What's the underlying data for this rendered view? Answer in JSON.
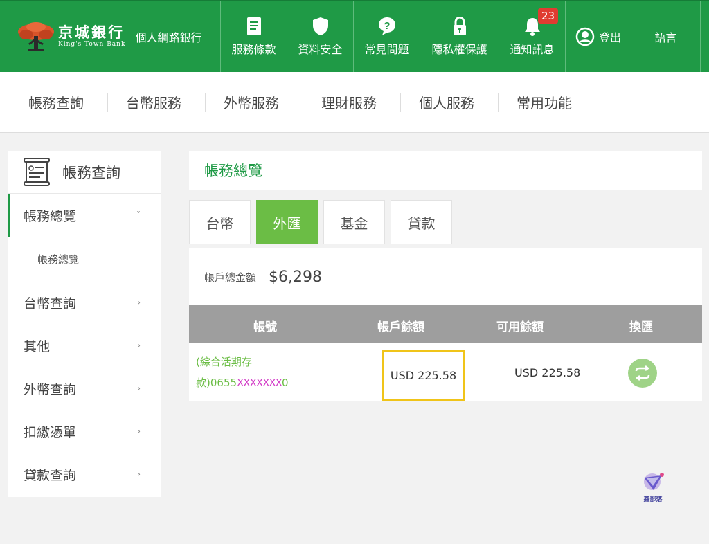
{
  "brand": {
    "name_cn": "京城銀行",
    "name_en": "King's Town Bank",
    "subtitle": "個人網路銀行"
  },
  "header_nav": [
    {
      "label": "服務條款",
      "icon": "document-icon"
    },
    {
      "label": "資料安全",
      "icon": "shield-icon"
    },
    {
      "label": "常見問題",
      "icon": "question-icon"
    },
    {
      "label": "隱私權保護",
      "icon": "lock-icon"
    },
    {
      "label": "通知訊息",
      "icon": "bell-icon",
      "badge": "23"
    },
    {
      "label": "登出",
      "icon": "user-icon"
    },
    {
      "label": "語言"
    }
  ],
  "main_nav": [
    "帳務查詢",
    "台幣服務",
    "外幣服務",
    "理財服務",
    "個人服務",
    "常用功能"
  ],
  "sidebar": {
    "title": "帳務查詢",
    "items": [
      {
        "label": "帳務總覽",
        "chevron": "˅",
        "active": true
      },
      {
        "label": "帳務總覽",
        "sub": true
      },
      {
        "label": "台幣查詢",
        "chevron": "›"
      },
      {
        "label": "其他",
        "chevron": "›"
      },
      {
        "label": "外幣查詢",
        "chevron": "›"
      },
      {
        "label": "扣繳憑單",
        "chevron": "›"
      },
      {
        "label": "貸款查詢",
        "chevron": "›"
      }
    ]
  },
  "page": {
    "title": "帳務總覽",
    "tabs": [
      "台幣",
      "外匯",
      "基金",
      "貸款"
    ],
    "active_tab": "外匯",
    "total_label": "帳戶總金額",
    "total_value": "$6,298",
    "table": {
      "headers": [
        "帳號",
        "帳戶餘額",
        "可用餘額",
        "換匯"
      ],
      "rows": [
        {
          "account_line1": "(綜合活期存",
          "account_line2_prefix": "款)0655",
          "account_mask": "XXXXXXX",
          "account_suffix": "0",
          "balance": "USD 225.58",
          "available": "USD 225.58"
        }
      ]
    }
  },
  "watermark": {
    "text": "鑫部落"
  },
  "colors": {
    "brand_green": "#1f9a46",
    "tab_green": "#6bbd45",
    "highlight": "#f0c419",
    "badge_red": "#e03c31"
  }
}
